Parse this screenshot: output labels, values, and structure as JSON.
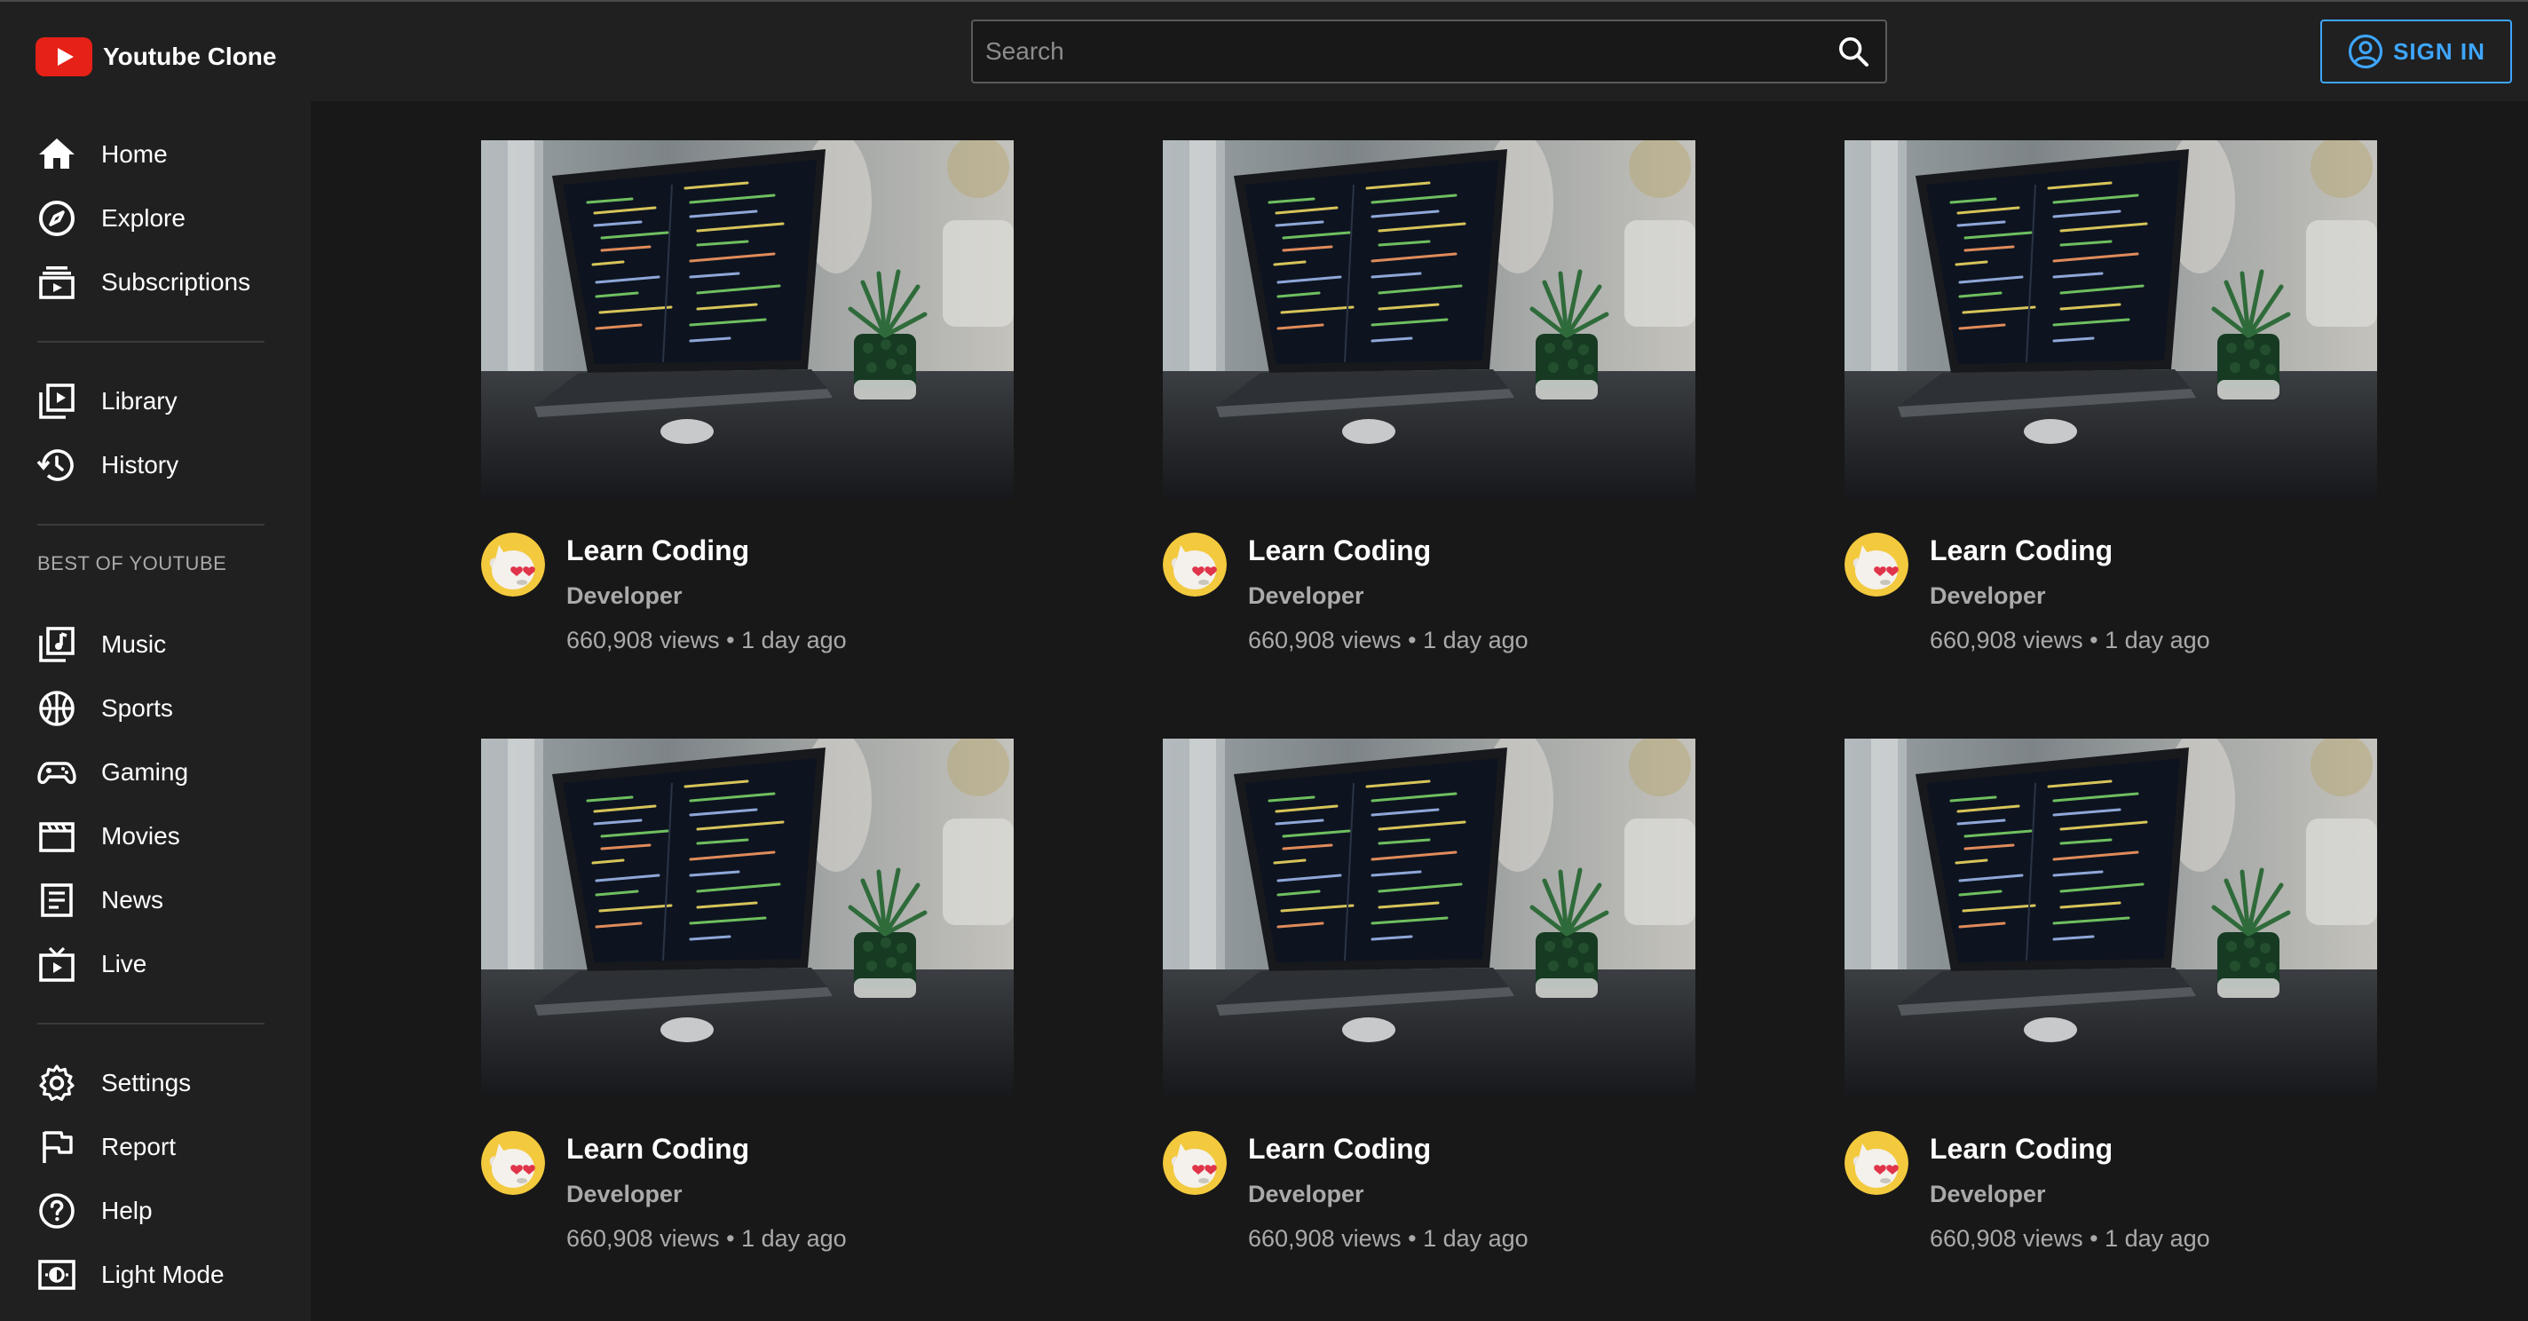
{
  "app": {
    "name": "Youtube Clone",
    "search_placeholder": "Search",
    "search_value": "",
    "signin_label": "SIGN IN"
  },
  "colors": {
    "background": "#181818",
    "panel": "#202020",
    "accent": "#3ea6ff",
    "logo_red": "#e62117",
    "secondary_text": "#aaaaaa"
  },
  "sidebar": {
    "main": [
      {
        "label": "Home",
        "icon": "home-icon"
      },
      {
        "label": "Explore",
        "icon": "compass-icon"
      },
      {
        "label": "Subscriptions",
        "icon": "subscriptions-icon"
      }
    ],
    "you": [
      {
        "label": "Library",
        "icon": "library-icon"
      },
      {
        "label": "History",
        "icon": "history-icon"
      }
    ],
    "best_title": "BEST OF YOUTUBE",
    "best": [
      {
        "label": "Music",
        "icon": "music-icon"
      },
      {
        "label": "Sports",
        "icon": "sports-icon"
      },
      {
        "label": "Gaming",
        "icon": "gaming-icon"
      },
      {
        "label": "Movies",
        "icon": "movies-icon"
      },
      {
        "label": "News",
        "icon": "news-icon"
      },
      {
        "label": "Live",
        "icon": "live-icon"
      }
    ],
    "bottom": [
      {
        "label": "Settings",
        "icon": "gear-icon"
      },
      {
        "label": "Report",
        "icon": "flag-icon"
      },
      {
        "label": "Help",
        "icon": "help-icon"
      },
      {
        "label": "Light Mode",
        "icon": "light-mode-icon"
      }
    ]
  },
  "videos": [
    {
      "title": "Learn Coding",
      "channel": "Developer",
      "meta": "660,908 views • 1 day ago"
    },
    {
      "title": "Learn Coding",
      "channel": "Developer",
      "meta": "660,908 views • 1 day ago"
    },
    {
      "title": "Learn Coding",
      "channel": "Developer",
      "meta": "660,908 views • 1 day ago"
    },
    {
      "title": "Learn Coding",
      "channel": "Developer",
      "meta": "660,908 views • 1 day ago"
    },
    {
      "title": "Learn Coding",
      "channel": "Developer",
      "meta": "660,908 views • 1 day ago"
    },
    {
      "title": "Learn Coding",
      "channel": "Developer",
      "meta": "660,908 views • 1 day ago"
    }
  ]
}
